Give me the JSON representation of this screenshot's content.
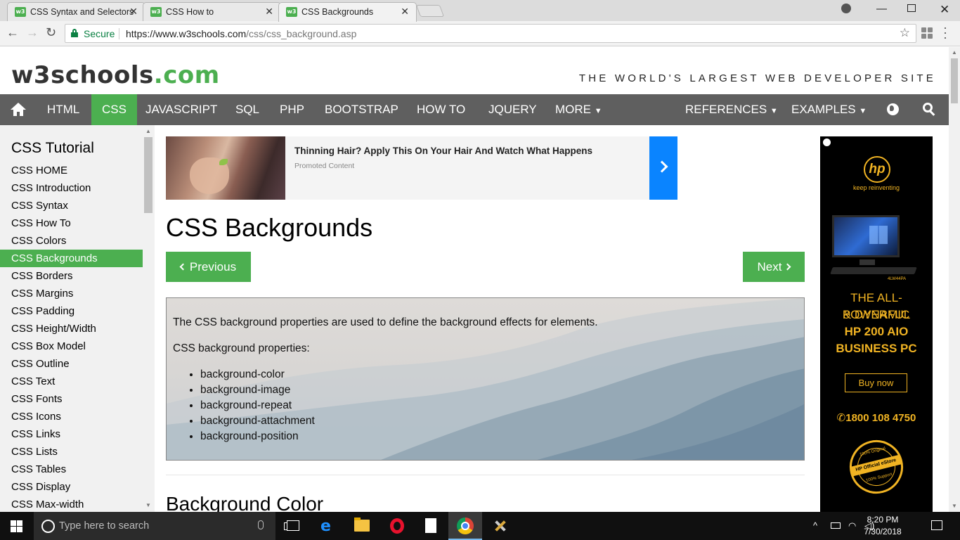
{
  "browser": {
    "tabs": [
      {
        "label": "CSS Syntax and Selectors",
        "active": false
      },
      {
        "label": "CSS How to",
        "active": false
      },
      {
        "label": "CSS Backgrounds",
        "active": true
      }
    ],
    "favicon_text": "w3",
    "address": {
      "secure_label": "Secure",
      "url_host": "https://www.w3schools.com",
      "url_path": "/css/css_background.asp"
    }
  },
  "site": {
    "logo_main": "w3schools",
    "logo_suffix": ".com",
    "tagline": "THE WORLD'S LARGEST WEB DEVELOPER SITE",
    "accent_color": "#4caf50",
    "nav_bg_color": "#5f5f5f",
    "nav": {
      "items": [
        "HTML",
        "CSS",
        "JAVASCRIPT",
        "SQL",
        "PHP",
        "BOOTSTRAP",
        "HOW TO",
        "JQUERY",
        "MORE"
      ],
      "active": "CSS",
      "right_items": [
        "REFERENCES",
        "EXAMPLES"
      ]
    }
  },
  "sidebar": {
    "heading": "CSS Tutorial",
    "items": [
      "CSS HOME",
      "CSS Introduction",
      "CSS Syntax",
      "CSS How To",
      "CSS Colors",
      "CSS Backgrounds",
      "CSS Borders",
      "CSS Margins",
      "CSS Padding",
      "CSS Height/Width",
      "CSS Box Model",
      "CSS Outline",
      "CSS Text",
      "CSS Fonts",
      "CSS Icons",
      "CSS Links",
      "CSS Lists",
      "CSS Tables",
      "CSS Display",
      "CSS Max-width"
    ],
    "active": "CSS Backgrounds"
  },
  "ad_banner": {
    "headline": "Thinning Hair? Apply This On Your Hair And Watch What Happens",
    "sub": "Promoted Content"
  },
  "main": {
    "title": "CSS Backgrounds",
    "prev_label": "Previous",
    "next_label": "Next",
    "intro": "The CSS background properties are used to define the background effects for elements.",
    "props_heading": "CSS background properties:",
    "properties": [
      "background-color",
      "background-image",
      "background-repeat",
      "background-attachment",
      "background-position"
    ],
    "section_heading": "Background Color"
  },
  "hp_ad": {
    "logo": "hp",
    "slogan": "keep reinventing",
    "model": "4LW44PA",
    "headline_lines": [
      "THE ALL-POWERFUL",
      "& DYNAMIC"
    ],
    "product_lines": [
      "HP 200 AIO",
      "BUSINESS PC"
    ],
    "buy_label": "Buy now",
    "phone": "1800 108 4750",
    "seal_top": "100% Original",
    "seal_band": "HP Official eStore",
    "seal_bottom": "100% Support",
    "accent_color": "#f0b323"
  },
  "taskbar": {
    "search_placeholder": "Type here to search",
    "time": "8:20 PM",
    "date": "7/30/2018"
  }
}
